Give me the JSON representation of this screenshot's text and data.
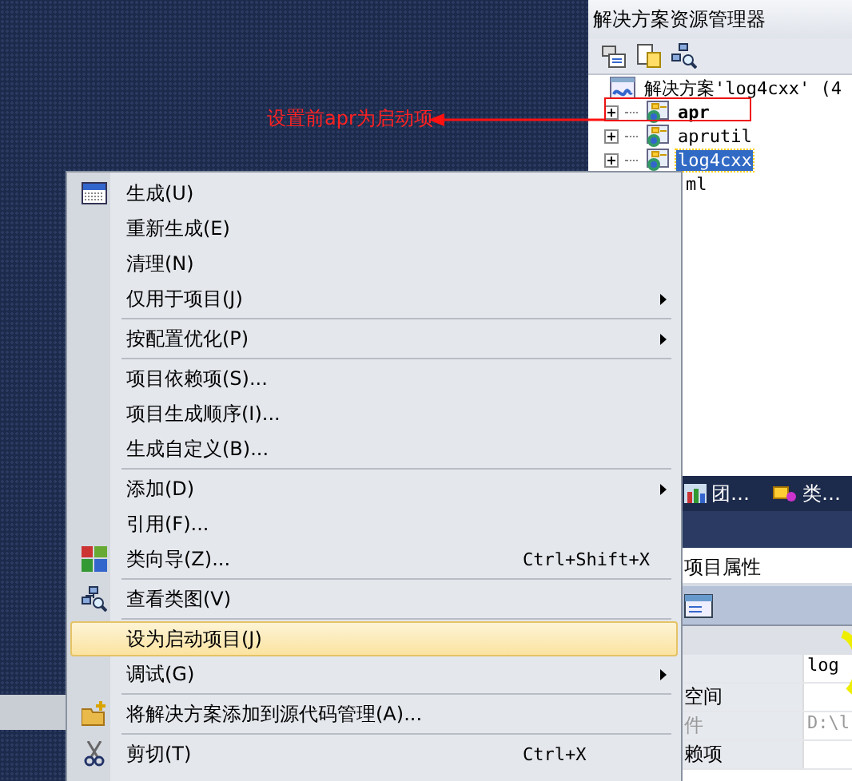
{
  "annotation": {
    "text": "设置前apr为启动项"
  },
  "explorer": {
    "title": "解决方案资源管理器",
    "tree": [
      {
        "label": "解决方案'log4cxx' (4",
        "expanded": true,
        "selected": false,
        "children": [
          {
            "kind": "project",
            "label": "apr",
            "expanded": false,
            "selected": false,
            "bold": true
          },
          {
            "kind": "project",
            "label": "aprutil",
            "expanded": false,
            "selected": false,
            "bold": false
          },
          {
            "kind": "project",
            "label": "log4cxx",
            "expanded": false,
            "selected": true,
            "bold": false
          },
          {
            "kind": "covered",
            "label": "ml",
            "selected": false,
            "bold": false
          }
        ]
      }
    ]
  },
  "tool_tabs": [
    {
      "label": "团…"
    },
    {
      "label": "类…"
    }
  ],
  "properties": {
    "title": "项目属性",
    "rows": [
      {
        "value": "log",
        "disabled": false
      },
      {
        "name": "空间",
        "disabled": false
      },
      {
        "name": "件",
        "value": "D:\\l",
        "disabled": true
      },
      {
        "name": "赖项",
        "disabled": false
      }
    ]
  },
  "context_menu": {
    "items": [
      {
        "kind": "item",
        "label": "生成(U)",
        "selected": false,
        "submenu": false
      },
      {
        "kind": "item",
        "label": "重新生成(E)",
        "selected": false,
        "submenu": false
      },
      {
        "kind": "item",
        "label": "清理(N)",
        "selected": false,
        "submenu": false
      },
      {
        "kind": "item",
        "label": "仅用于项目(J)",
        "selected": false,
        "submenu": true
      },
      {
        "kind": "separator"
      },
      {
        "kind": "item",
        "label": "按配置优化(P)",
        "selected": false,
        "submenu": true
      },
      {
        "kind": "separator"
      },
      {
        "kind": "item",
        "label": "项目依赖项(S)...",
        "selected": false,
        "submenu": false
      },
      {
        "kind": "item",
        "label": "项目生成顺序(I)...",
        "selected": false,
        "submenu": false
      },
      {
        "kind": "item",
        "label": "生成自定义(B)...",
        "selected": false,
        "submenu": false
      },
      {
        "kind": "separator"
      },
      {
        "kind": "item",
        "label": "添加(D)",
        "selected": false,
        "submenu": true
      },
      {
        "kind": "item",
        "label": "引用(F)...",
        "selected": false,
        "submenu": false
      },
      {
        "kind": "item",
        "label": "类向导(Z)...",
        "shortcut": "Ctrl+Shift+X",
        "selected": false,
        "submenu": false
      },
      {
        "kind": "separator"
      },
      {
        "kind": "item",
        "label": "查看类图(V)",
        "selected": false,
        "submenu": false
      },
      {
        "kind": "separator"
      },
      {
        "kind": "item",
        "label": "设为启动项目(J)",
        "selected": true,
        "submenu": false
      },
      {
        "kind": "item",
        "label": "调试(G)",
        "selected": false,
        "submenu": true
      },
      {
        "kind": "separator"
      },
      {
        "kind": "item",
        "label": "将解决方案添加到源代码管理(A)...",
        "selected": false,
        "submenu": false
      },
      {
        "kind": "separator"
      },
      {
        "kind": "item",
        "label": "剪切(T)",
        "shortcut": "Ctrl+X",
        "selected": false,
        "submenu": false
      }
    ]
  }
}
